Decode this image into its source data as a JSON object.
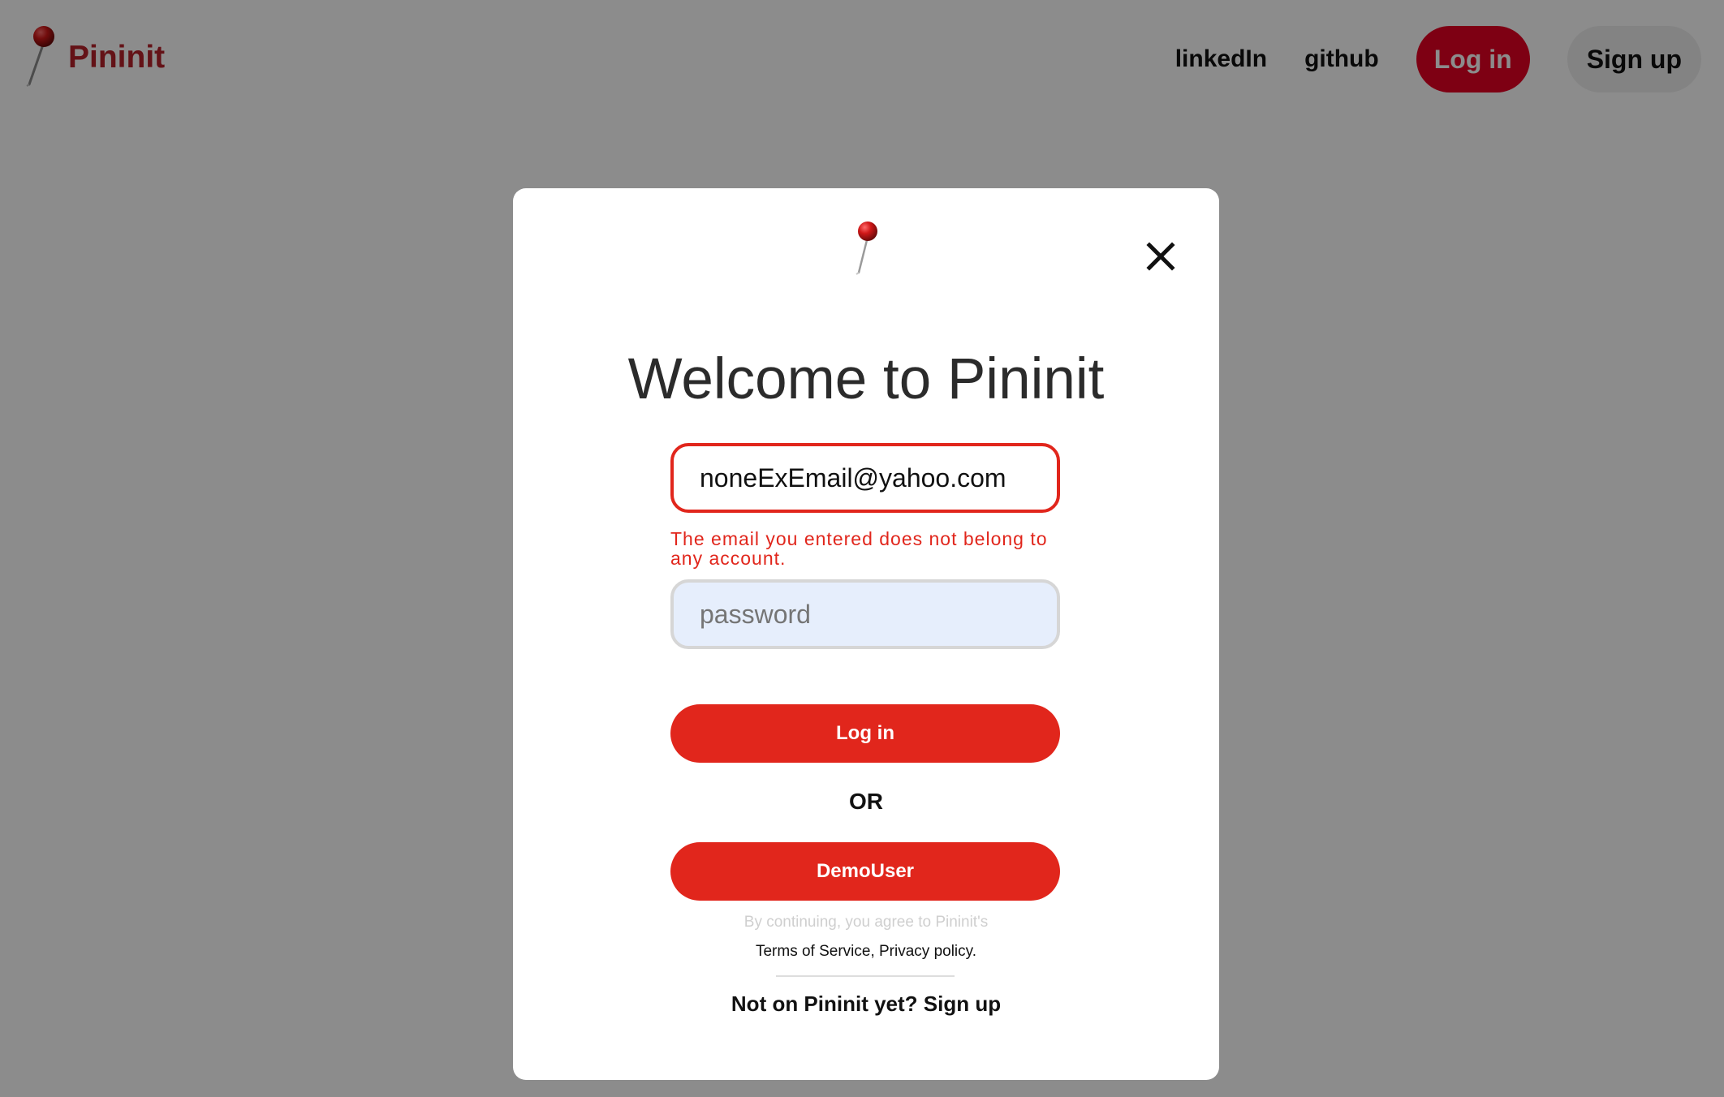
{
  "navbar": {
    "brand_name": "Pininit",
    "brand_icon": "pushpin-icon",
    "links": {
      "linkedin": "linkedIn",
      "github": "github"
    },
    "login_label": "Log in",
    "signup_label": "Sign up"
  },
  "modal": {
    "logo_icon": "pushpin-icon",
    "close_icon": "close-icon",
    "title": "Welcome to Pininit",
    "email": {
      "value": "noneExEmail@yahoo.com",
      "error": "The email you entered does not belong to any account."
    },
    "password": {
      "value": "",
      "placeholder": "password"
    },
    "login_label": "Log in",
    "or_label": "OR",
    "demo_label": "DemoUser",
    "tos_prefix": "By continuing, you agree to Pininit's",
    "tos_links": "Terms of Service, Privacy policy.",
    "signup_prompt": "Not on Pininit yet? Sign up"
  },
  "colors": {
    "brand_red": "#e60023",
    "button_red": "#e1261c",
    "error_red": "#e1261c",
    "overlay": "rgba(0,0,0,0.45)"
  }
}
